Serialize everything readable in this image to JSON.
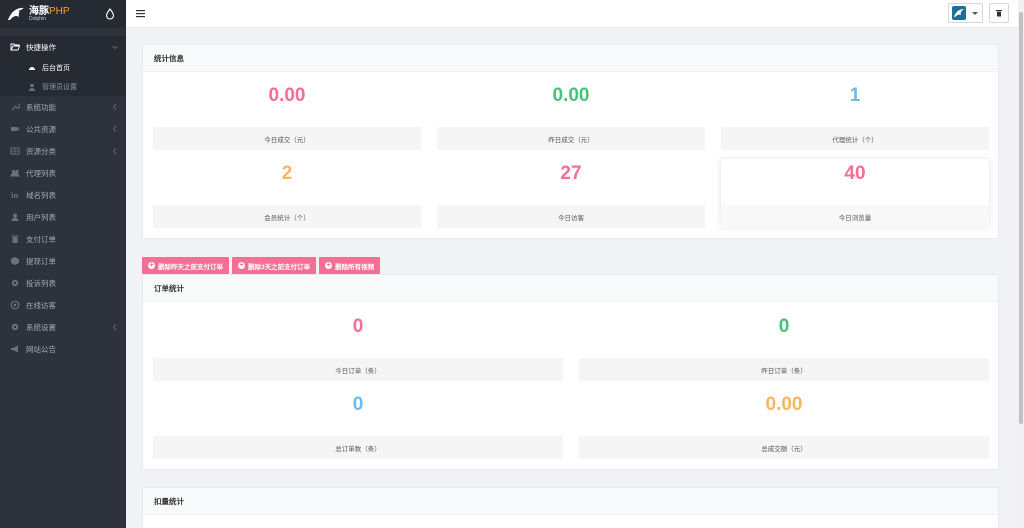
{
  "app": {
    "logo_main": "海豚",
    "logo_php": "PHP",
    "logo_sub": "Dolphin",
    "brand_color": "#f5a623"
  },
  "sidebar": {
    "group_label": "快捷操作",
    "sub_items": [
      {
        "label": "后台首页",
        "icon": "dashboard-icon",
        "active": true
      },
      {
        "label": "管理员设置",
        "icon": "user-icon",
        "active": false
      }
    ],
    "items": [
      {
        "label": "系统功能",
        "icon": "wrench-icon",
        "has_children": true
      },
      {
        "label": "公共资源",
        "icon": "video-icon",
        "has_children": true
      },
      {
        "label": "资源分类",
        "icon": "grid-icon",
        "has_children": true
      },
      {
        "label": "代理列表",
        "icon": "users-icon",
        "has_children": false
      },
      {
        "label": "域名列表",
        "icon": "linkedin-icon",
        "has_children": false
      },
      {
        "label": "用户列表",
        "icon": "user-icon",
        "has_children": false
      },
      {
        "label": "支付订单",
        "icon": "trash-icon",
        "has_children": false
      },
      {
        "label": "提现订单",
        "icon": "box-icon",
        "has_children": false
      },
      {
        "label": "投诉列表",
        "icon": "gear-icon",
        "has_children": false
      },
      {
        "label": "在线访客",
        "icon": "chrome-icon",
        "has_children": false
      },
      {
        "label": "系统设置",
        "icon": "gear-icon",
        "has_children": true
      },
      {
        "label": "网站公告",
        "icon": "bullhorn-icon",
        "has_children": false
      }
    ]
  },
  "stats_panel": {
    "title": "统计信息",
    "items": [
      {
        "value": "0.00",
        "label": "今日成交（元）",
        "color": "#f56e96"
      },
      {
        "value": "0.00",
        "label": "昨日成交（元）",
        "color": "#46c37b"
      },
      {
        "value": "1",
        "label": "代理统计（个）",
        "color": "#70b9eb"
      },
      {
        "value": "2",
        "label": "会员统计（个）",
        "color": "#f3b760"
      },
      {
        "value": "27",
        "label": "今日访客",
        "color": "#f56e96"
      },
      {
        "value": "40",
        "label": "今日浏览量",
        "color": "#f56e96"
      }
    ]
  },
  "actions": {
    "buttons": [
      "删除昨天之前支付订单",
      "删除3天之前支付订单",
      "删除所有视频"
    ]
  },
  "order_panel": {
    "title": "订单统计",
    "items": [
      {
        "value": "0",
        "label": "今日订单（条）",
        "color": "#f56e96"
      },
      {
        "value": "0",
        "label": "昨日订单（条）",
        "color": "#46c37b"
      },
      {
        "value": "0",
        "label": "总订单数（条）",
        "color": "#70b9eb"
      },
      {
        "value": "0.00",
        "label": "总成交额（元）",
        "color": "#f3b760"
      }
    ]
  },
  "deduct_panel": {
    "title": "扣量统计"
  }
}
